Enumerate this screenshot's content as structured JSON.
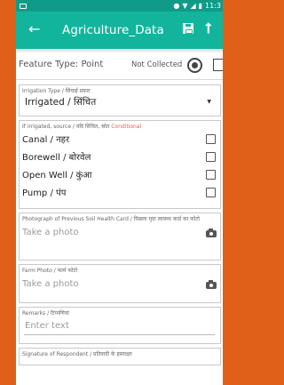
{
  "status_bar": {
    "time": "11:3"
  },
  "toolbar": {
    "title": "Agriculture_Data",
    "back_icon": "arrow-left-icon",
    "save_icon": "save-icon",
    "upload_icon": "upload-icon"
  },
  "feature": {
    "type_label": "Feature Type: Point",
    "status": "Not Collected"
  },
  "irrigation_type": {
    "label": "Irrigation Type / सिंचाई प्रकार",
    "value": "Irrigated / सिंचित"
  },
  "irrigation_source": {
    "label": "If irrigated, source / यदि सिंचित, स्रोत",
    "conditional": "Conditional",
    "options": [
      "Canal / नहर",
      "Borewell / बोरवेल",
      "Open Well / कुंआ",
      "Pump / पंप"
    ]
  },
  "soil_card_photo": {
    "label": "Photograph of Previous Soil Health Card / पिछला मृदा स्वास्थ्य कार्ड का फोटो",
    "placeholder": "Take a photo"
  },
  "farm_photo": {
    "label": "Farm Photo / फार्म फोटो",
    "placeholder": "Take a photo"
  },
  "remarks": {
    "label": "Remarks / टिप्पणियां",
    "placeholder": "Enter text"
  },
  "signature": {
    "label": "Signature of Respondent / प्रतिवादी के हस्ताक्षर"
  },
  "colors": {
    "toolbar": "#12b59c",
    "status_bar": "#0f9b88",
    "background": "#e0601a"
  }
}
